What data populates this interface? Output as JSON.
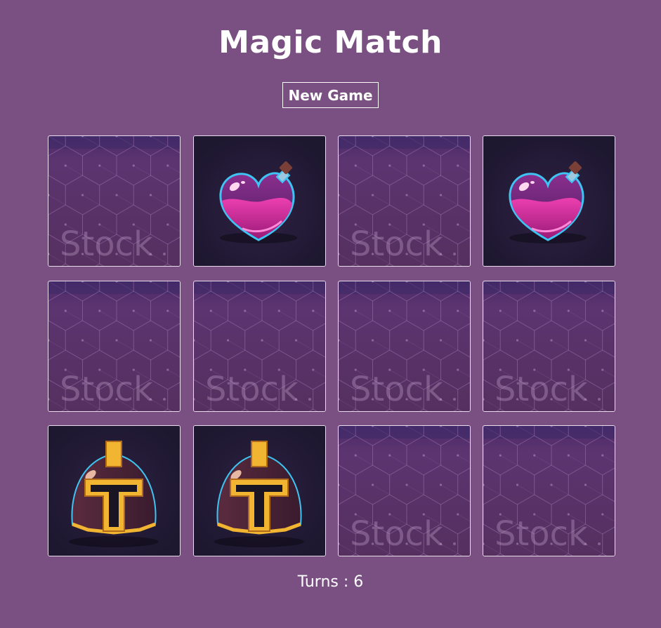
{
  "game": {
    "title": "Magic Match",
    "new_game_label": "New Game",
    "turns_text": "Turns : 6",
    "watermark_text": "Stock"
  },
  "board": {
    "rows": 3,
    "cols": 4,
    "cards": [
      {
        "state": "face-down"
      },
      {
        "state": "face-up",
        "icon": "potion-icon"
      },
      {
        "state": "face-down"
      },
      {
        "state": "face-up",
        "icon": "potion-icon"
      },
      {
        "state": "face-down"
      },
      {
        "state": "face-down"
      },
      {
        "state": "face-down"
      },
      {
        "state": "face-down"
      },
      {
        "state": "face-up",
        "icon": "helmet-icon"
      },
      {
        "state": "face-up",
        "icon": "helmet-icon"
      },
      {
        "state": "face-down"
      },
      {
        "state": "face-down"
      }
    ]
  },
  "colors": {
    "background": "#7a5082",
    "card_back": "#5b3468",
    "card_face": "#221a33",
    "accent_gold": "#f2b531",
    "accent_cyan": "#3ec3f2",
    "potion_pink": "#c0208a"
  }
}
